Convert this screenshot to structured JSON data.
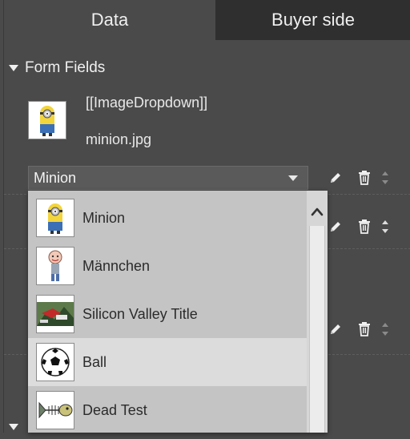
{
  "tabs": [
    {
      "label": "Data",
      "active": true
    },
    {
      "label": "Buyer side",
      "active": false
    }
  ],
  "section": {
    "title": "Form Fields"
  },
  "field": {
    "name": "[[ImageDropdown]]",
    "file": "minion.jpg",
    "thumb_icon": "minion-icon"
  },
  "select": {
    "value": "Minion"
  },
  "dropdown": {
    "options": [
      {
        "label": "Minion",
        "icon": "minion-icon"
      },
      {
        "label": "Männchen",
        "icon": "cartoon-man-icon"
      },
      {
        "label": "Silicon Valley Title",
        "icon": "silicon-valley-title-icon"
      },
      {
        "label": "Ball",
        "icon": "soccer-ball-icon"
      },
      {
        "label": "Dead Test",
        "icon": "fish-skeleton-icon"
      }
    ],
    "highlighted_index": 3
  },
  "colors": {
    "panel_bg": "#4a4a4a",
    "inactive_tab": "#2f2f2f",
    "dropdown_bg": "#c4c4c4",
    "dropdown_highlight": "#dcdcdc"
  }
}
